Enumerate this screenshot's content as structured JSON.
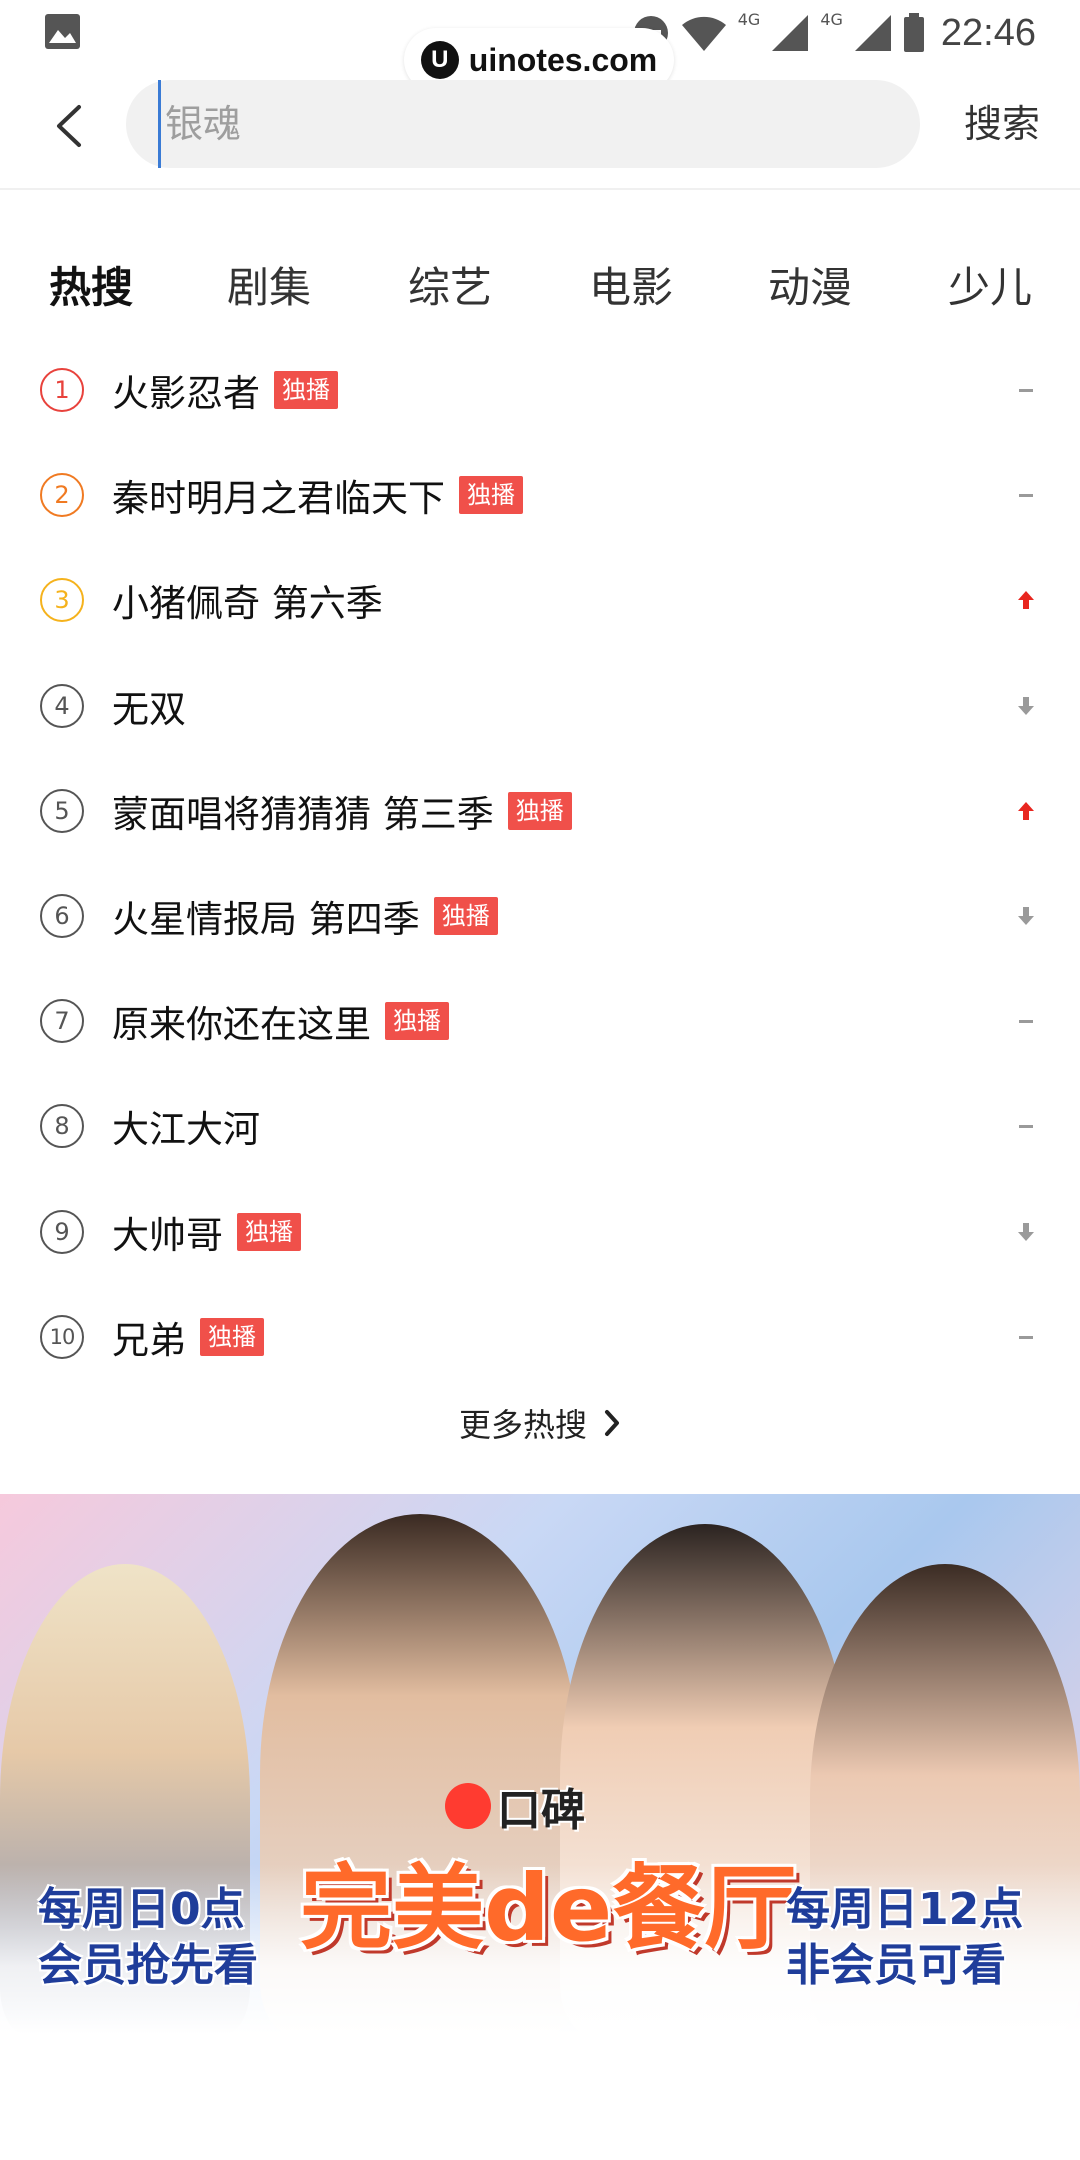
{
  "status_bar": {
    "time": "22:46",
    "network_1": "4G",
    "network_2": "4G",
    "watermark": "uinotes.com"
  },
  "search": {
    "placeholder": "银魂",
    "button_label": "搜索"
  },
  "tabs": [
    {
      "label": "热搜",
      "active": true
    },
    {
      "label": "剧集",
      "active": false
    },
    {
      "label": "综艺",
      "active": false
    },
    {
      "label": "电影",
      "active": false
    },
    {
      "label": "动漫",
      "active": false
    },
    {
      "label": "少儿",
      "active": false
    }
  ],
  "hot_list": [
    {
      "rank": "1",
      "title": "火影忍者",
      "badge": "独播",
      "trend": "flat"
    },
    {
      "rank": "2",
      "title": "秦时明月之君临天下",
      "badge": "独播",
      "trend": "flat"
    },
    {
      "rank": "3",
      "title": "小猪佩奇 第六季",
      "badge": "",
      "trend": "up"
    },
    {
      "rank": "4",
      "title": "无双",
      "badge": "",
      "trend": "down"
    },
    {
      "rank": "5",
      "title": "蒙面唱将猜猜猜 第三季",
      "badge": "独播",
      "trend": "up"
    },
    {
      "rank": "6",
      "title": "火星情报局 第四季",
      "badge": "独播",
      "trend": "down"
    },
    {
      "rank": "7",
      "title": "原来你还在这里",
      "badge": "独播",
      "trend": "flat"
    },
    {
      "rank": "8",
      "title": "大江大河",
      "badge": "",
      "trend": "flat"
    },
    {
      "rank": "9",
      "title": "大帅哥",
      "badge": "独播",
      "trend": "down"
    },
    {
      "rank": "10",
      "title": "兄弟",
      "badge": "独播",
      "trend": "flat"
    }
  ],
  "more": {
    "label": "更多热搜"
  },
  "banner": {
    "brand": "口碑",
    "title": "完美de餐厅",
    "left_line1": "每周日0点",
    "left_line2": "会员抢先看",
    "right_line1": "每周日12点",
    "right_line2": "非会员可看"
  },
  "colors": {
    "rank1": "#e8423c",
    "rank2": "#f07a22",
    "rank3": "#f5b21c",
    "badge": "#f0504a",
    "trend_up": "#e8261f",
    "trend_other": "#9a9a9a"
  }
}
